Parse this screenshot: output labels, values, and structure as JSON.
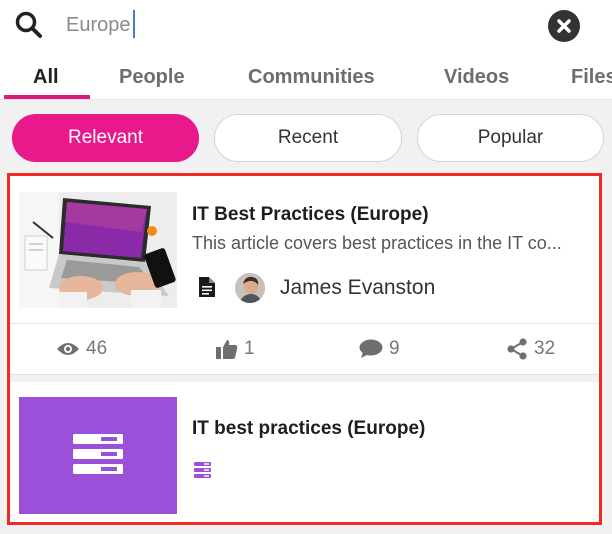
{
  "search": {
    "value": "Europe",
    "icon": "search-icon",
    "clear_icon": "close-circle-icon"
  },
  "tabs": [
    {
      "label": "All",
      "active": true
    },
    {
      "label": "People",
      "active": false
    },
    {
      "label": "Communities",
      "active": false
    },
    {
      "label": "Videos",
      "active": false
    },
    {
      "label": "Files",
      "active": false
    }
  ],
  "filters": [
    {
      "label": "Relevant",
      "active": true
    },
    {
      "label": "Recent",
      "active": false
    },
    {
      "label": "Popular",
      "active": false
    }
  ],
  "results": [
    {
      "title": "IT Best Practices (Europe)",
      "description": "This article covers best practices in the IT co...",
      "type_icon": "document-icon",
      "author": "James Evanston",
      "stats": {
        "views": "46",
        "likes": "1",
        "comments": "9",
        "shares": "32"
      }
    },
    {
      "title": "IT best practices (Europe)",
      "type_icon": "server-icon"
    }
  ],
  "colors": {
    "accent": "#e8198a",
    "highlight": "#ee2b24",
    "thumbnail_purple": "#9c4fd8"
  }
}
